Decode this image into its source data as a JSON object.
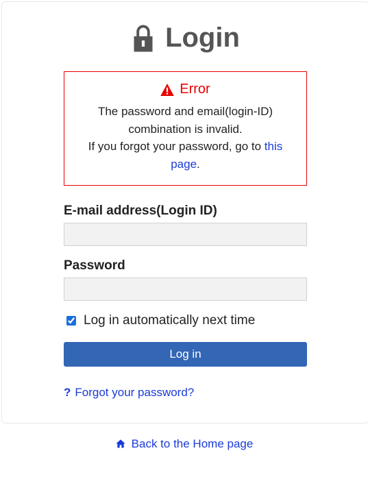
{
  "title": "Login",
  "error": {
    "title": "Error",
    "message_line1": "The password and email(login-ID) combination is invalid.",
    "message_line2_prefix": "If you forgot your password, go to ",
    "message_link": "this page",
    "message_line2_suffix": "."
  },
  "fields": {
    "email_label": "E-mail address(Login ID)",
    "email_value": "",
    "password_label": "Password",
    "password_value": ""
  },
  "remember": {
    "label": "Log in automatically next time",
    "checked": true
  },
  "submit_label": "Log in",
  "forgot_label": "Forgot your password?",
  "back_label": "Back to the Home page"
}
